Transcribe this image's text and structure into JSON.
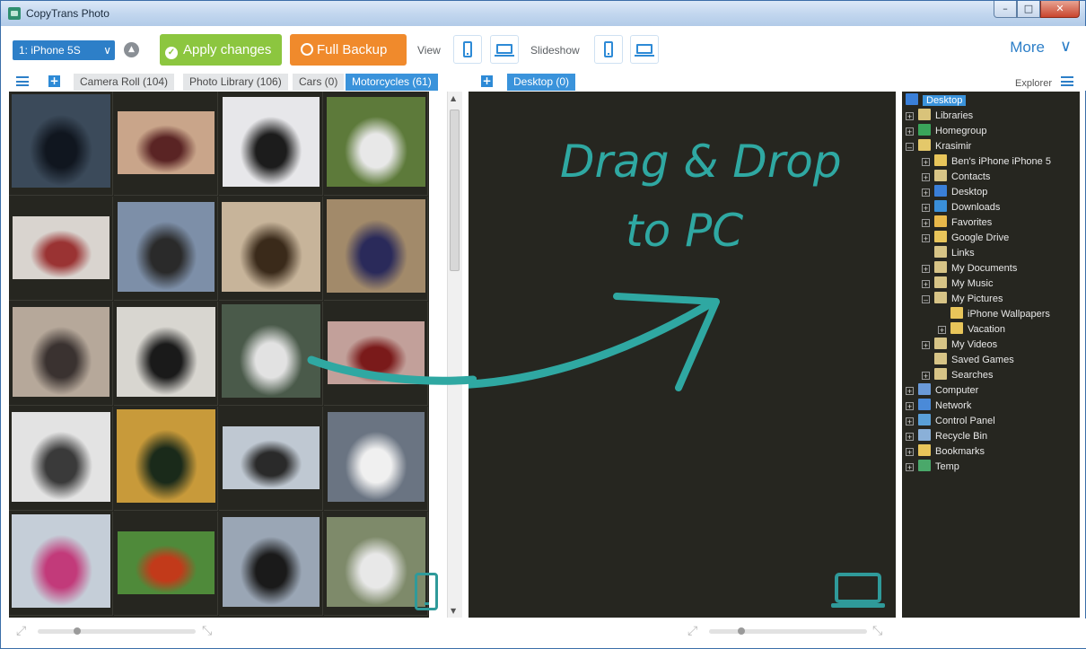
{
  "window": {
    "title": "CopyTrans Photo",
    "controls": [
      "–",
      "□",
      "✕"
    ]
  },
  "toolbar": {
    "device": "1: iPhone 5S",
    "apply_label": "Apply changes",
    "backup_label": "Full Backup",
    "view_label": "View",
    "slideshow_label": "Slideshow",
    "more_label": "More"
  },
  "tabs": {
    "left": [
      {
        "label": "Camera Roll  (104)",
        "active": false
      },
      {
        "label": "Photo Library (106)",
        "active": false
      },
      {
        "label": "Cars (0)",
        "active": false
      },
      {
        "label": "Motorcycles (61)",
        "active": true
      }
    ],
    "right": [
      {
        "label": "Desktop (0)",
        "active": true
      }
    ],
    "explorer_label": "Explorer"
  },
  "drop_hint": {
    "line1": "Drag & Drop",
    "line2": "to PC"
  },
  "photos": [
    {
      "bg": "#3b4a5a",
      "fg": "#10161f"
    },
    {
      "bg": "#c9a58a",
      "fg": "#5a2424"
    },
    {
      "bg": "#e7e7ea",
      "fg": "#1c1c1c"
    },
    {
      "bg": "#5d7a3a",
      "fg": "#e8e8e8"
    },
    {
      "bg": "#d9d4cf",
      "fg": "#9a3333"
    },
    {
      "bg": "#7d8fa8",
      "fg": "#2a2a2a"
    },
    {
      "bg": "#c7b49a",
      "fg": "#3a2a1a"
    },
    {
      "bg": "#a28a6a",
      "fg": "#2a2a5a"
    },
    {
      "bg": "#b6a89a",
      "fg": "#3a3230"
    },
    {
      "bg": "#d8d6d0",
      "fg": "#1a1a1a"
    },
    {
      "bg": "#4a5a4a",
      "fg": "#e2e2e2"
    },
    {
      "bg": "#c2a09a",
      "fg": "#7a1a1a"
    },
    {
      "bg": "#e3e3e3",
      "fg": "#3a3a3a"
    },
    {
      "bg": "#c89a3a",
      "fg": "#1a2a1a"
    },
    {
      "bg": "#bfc8d2",
      "fg": "#2a2a2a"
    },
    {
      "bg": "#6a7482",
      "fg": "#f0f0f0"
    },
    {
      "bg": "#c5ced8",
      "fg": "#c23a7a"
    },
    {
      "bg": "#4f8a3a",
      "fg": "#c23a1a"
    },
    {
      "bg": "#9aa6b5",
      "fg": "#1a1a1a"
    },
    {
      "bg": "#7e8a6a",
      "fg": "#e8e8e8"
    }
  ],
  "explorer": [
    {
      "label": "Desktop",
      "depth": 0,
      "exp": "",
      "icon": "#3a7fd8",
      "selected": true
    },
    {
      "label": "Libraries",
      "depth": 1,
      "exp": "+",
      "icon": "#d9c37a"
    },
    {
      "label": "Homegroup",
      "depth": 1,
      "exp": "+",
      "icon": "#3aa55a"
    },
    {
      "label": "Krasimir",
      "depth": 1,
      "exp": "–",
      "icon": "#e4c86a"
    },
    {
      "label": "Ben's iPhone iPhone 5",
      "depth": 2,
      "exp": "+",
      "icon": "#e8c55a"
    },
    {
      "label": "Contacts",
      "depth": 2,
      "exp": "+",
      "icon": "#d7c486"
    },
    {
      "label": "Desktop",
      "depth": 2,
      "exp": "+",
      "icon": "#3a7fd8"
    },
    {
      "label": "Downloads",
      "depth": 2,
      "exp": "+",
      "icon": "#3a8fd8"
    },
    {
      "label": "Favorites",
      "depth": 2,
      "exp": "+",
      "icon": "#e8b84a"
    },
    {
      "label": "Google Drive",
      "depth": 2,
      "exp": "+",
      "icon": "#e8c55a"
    },
    {
      "label": "Links",
      "depth": 2,
      "exp": "",
      "icon": "#d7c486"
    },
    {
      "label": "My Documents",
      "depth": 2,
      "exp": "+",
      "icon": "#d7c486"
    },
    {
      "label": "My Music",
      "depth": 2,
      "exp": "+",
      "icon": "#d7c486"
    },
    {
      "label": "My Pictures",
      "depth": 2,
      "exp": "–",
      "icon": "#d7c486"
    },
    {
      "label": "iPhone Wallpapers",
      "depth": 3,
      "exp": "",
      "icon": "#e8c55a"
    },
    {
      "label": "Vacation",
      "depth": 3,
      "exp": "+",
      "icon": "#e8c55a"
    },
    {
      "label": "My Videos",
      "depth": 2,
      "exp": "+",
      "icon": "#d7c486"
    },
    {
      "label": "Saved Games",
      "depth": 2,
      "exp": "",
      "icon": "#d7c486"
    },
    {
      "label": "Searches",
      "depth": 2,
      "exp": "+",
      "icon": "#d7c486"
    },
    {
      "label": "Computer",
      "depth": 1,
      "exp": "+",
      "icon": "#6a9ad8"
    },
    {
      "label": "Network",
      "depth": 1,
      "exp": "+",
      "icon": "#4a8ad8"
    },
    {
      "label": "Control Panel",
      "depth": 1,
      "exp": "+",
      "icon": "#5aa0d8"
    },
    {
      "label": "Recycle Bin",
      "depth": 1,
      "exp": "+",
      "icon": "#8ab0d8"
    },
    {
      "label": "Bookmarks",
      "depth": 1,
      "exp": "+",
      "icon": "#e8c55a"
    },
    {
      "label": "Temp",
      "depth": 1,
      "exp": "+",
      "icon": "#4aa86a"
    }
  ]
}
